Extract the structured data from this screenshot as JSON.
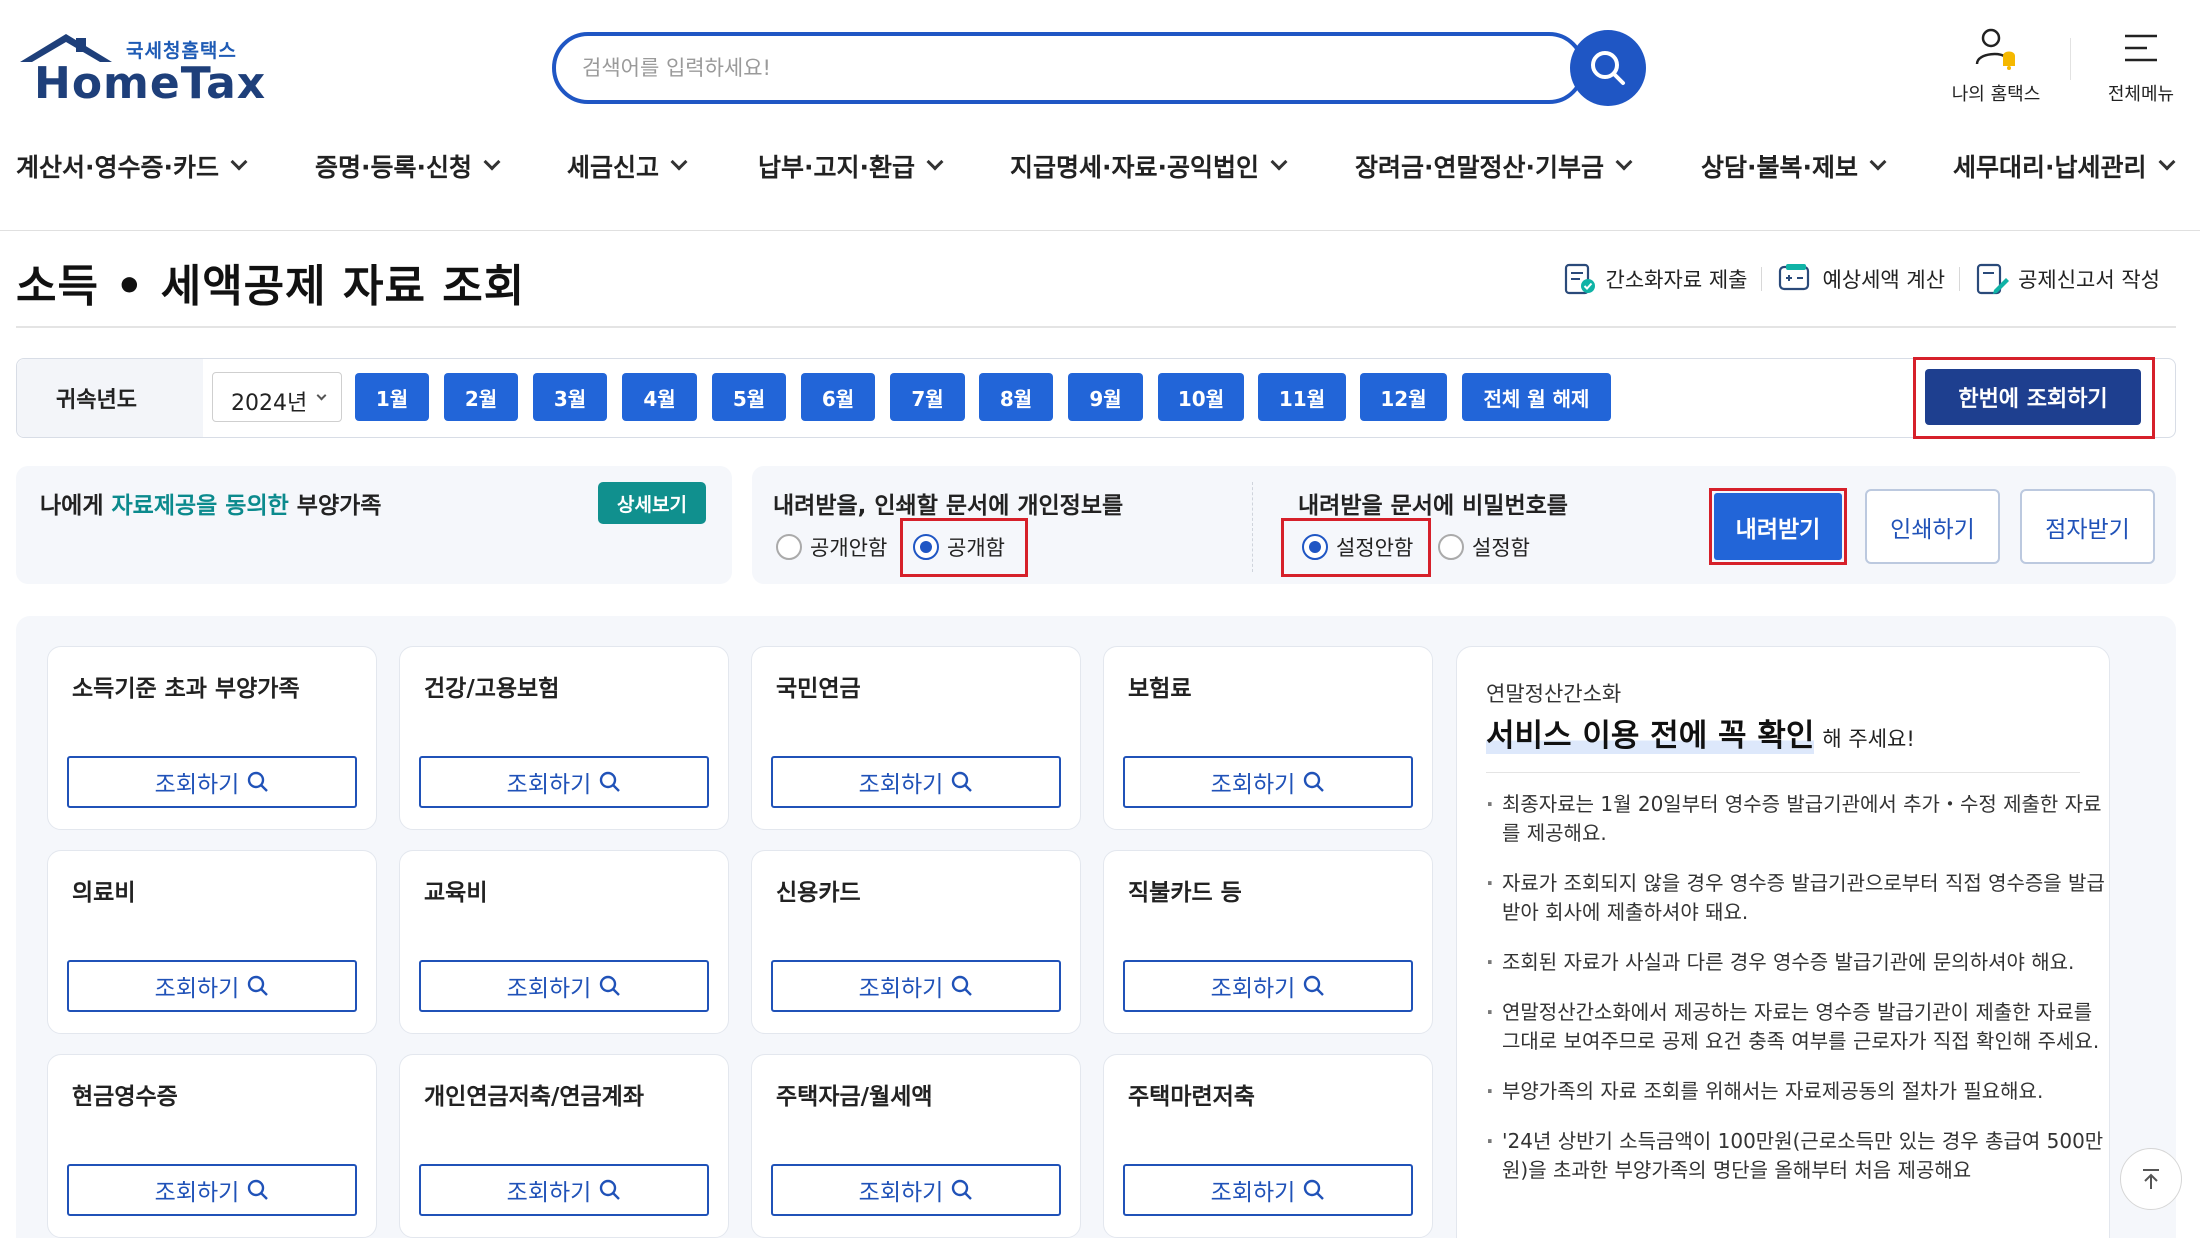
{
  "header": {
    "logo_sub": "국세청홈택스",
    "logo_main": "HomeTax",
    "search_placeholder": "검색어를 입력하세요!",
    "my_hometax": "나의 홈택스",
    "all_menu": "전체메뉴"
  },
  "nav": {
    "items": [
      "계산서·영수증·카드",
      "증명·등록·신청",
      "세금신고",
      "납부·고지·환급",
      "지급명세·자료·공익법인",
      "장려금·연말정산·기부금",
      "상담·불복·제보",
      "세무대리·납세관리"
    ]
  },
  "page": {
    "title": "소득 • 세액공제 자료 조회",
    "tools": [
      "간소화자료 제출",
      "예상세액 계산",
      "공제신고서 작성"
    ]
  },
  "yearbar": {
    "label": "귀속년도",
    "year_value": "2024년",
    "months": [
      "1월",
      "2월",
      "3월",
      "4월",
      "5월",
      "6월",
      "7월",
      "8월",
      "9월",
      "10월",
      "11월",
      "12월"
    ],
    "clear_all": "전체 월 해제",
    "lookup_all": "한번에 조회하기"
  },
  "dependents": {
    "prefix": "나에게 ",
    "highlight": "자료제공을 동의한",
    "suffix": " 부양가족",
    "detail_button": "상세보기"
  },
  "privacy_option": {
    "title": "내려받을, 인쇄할 문서에 개인정보를",
    "options": [
      "공개안함",
      "공개함"
    ],
    "selected": "공개함"
  },
  "password_option": {
    "title": "내려받을 문서에 비밀번호를",
    "options": [
      "설정안함",
      "설정함"
    ],
    "selected": "설정안함"
  },
  "actions": {
    "download": "내려받기",
    "print": "인쇄하기",
    "braille": "점자받기"
  },
  "cards": {
    "lookup_label": "조회하기",
    "items": [
      "소득기준 초과 부양가족",
      "건강/고용보험",
      "국민연금",
      "보험료",
      "의료비",
      "교육비",
      "신용카드",
      "직불카드 등",
      "현금영수증",
      "개인연금저축/연금계좌",
      "주택자금/월세액",
      "주택마련저축"
    ]
  },
  "notice": {
    "sub": "연말정산간소화",
    "head": "서비스 이용 전에 꼭 확인",
    "tail": "해 주세요!",
    "items": [
      "최종자료는 1월 20일부터 영수증 발급기관에서 추가・수정 제출한 자료를 제공해요.",
      "자료가 조회되지 않을 경우 영수증 발급기관으로부터 직접 영수증을 발급받아 회사에 제출하셔야 돼요.",
      "조회된 자료가 사실과 다른 경우 영수증 발급기관에 문의하셔야 해요.",
      "연말정산간소화에서 제공하는 자료는 영수증 발급기관이 제출한 자료를 그대로 보여주므로 공제 요건 충족 여부를 근로자가 직접 확인해 주세요.",
      "부양가족의 자료 조회를 위해서는 자료제공동의 절차가 필요해요.",
      "'24년 상반기 소득금액이 100만원(근로소득만 있는 경우 총급여 500만원)을 초과한 부양가족의 명단을 올해부터 처음 제공해요"
    ]
  },
  "colors": {
    "primary": "#2265d8",
    "navy": "#1e3f8f",
    "teal": "#10908e",
    "highlight_red": "#d6202a"
  }
}
